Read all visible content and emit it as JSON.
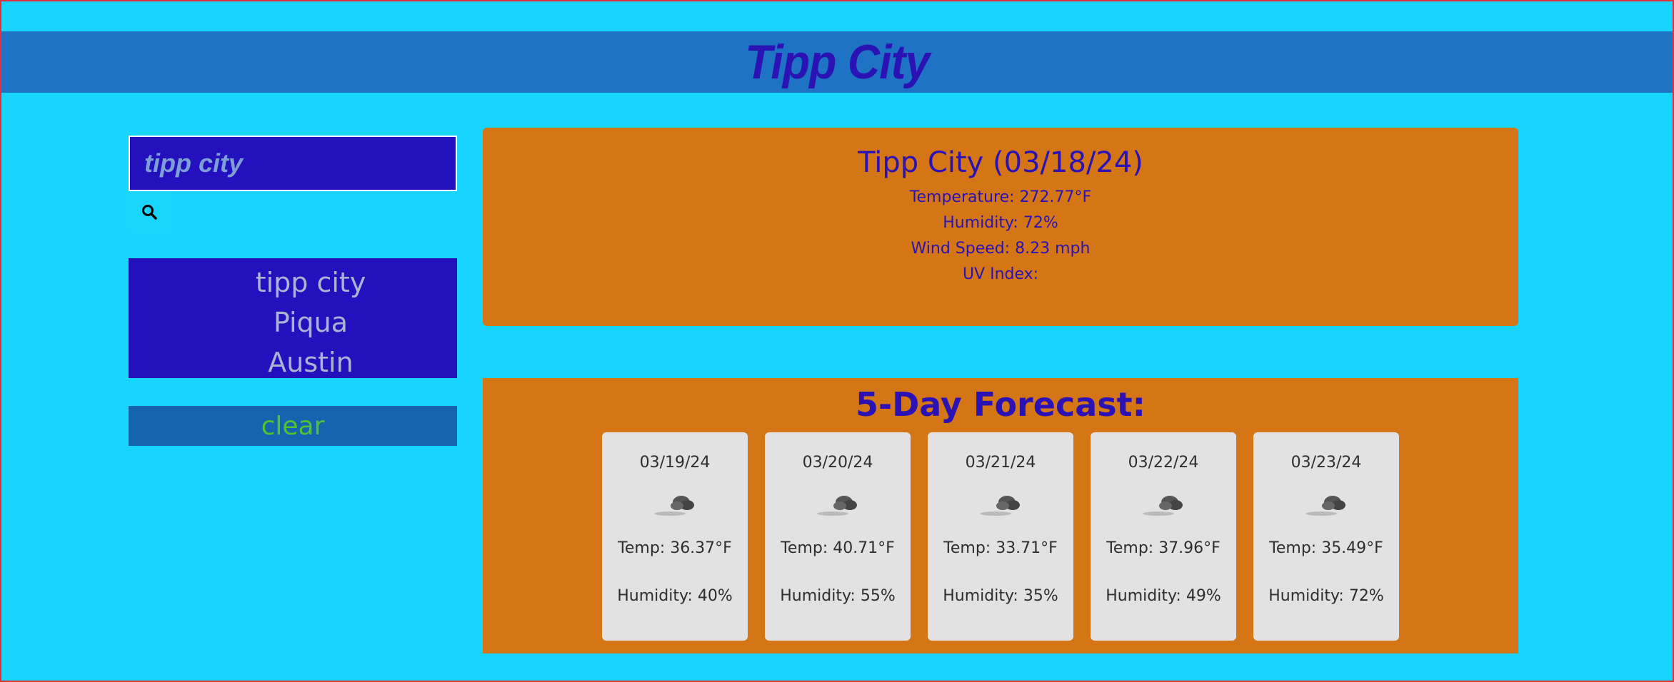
{
  "header": {
    "title": "Tipp City"
  },
  "search": {
    "value": "tipp city",
    "button_icon": "search-icon"
  },
  "history": {
    "items": [
      "tipp city",
      "Piqua",
      "Austin"
    ]
  },
  "clear_label": "clear",
  "current": {
    "title": "Tipp City (03/18/24)",
    "temperature": "Temperature: 272.77°F",
    "humidity": "Humidity: 72%",
    "wind": "Wind Speed: 8.23 mph",
    "uv": "UV Index:"
  },
  "forecast": {
    "heading": "5-Day Forecast:",
    "days": [
      {
        "date": "03/19/24",
        "icon": "cloud-icon",
        "temp": "Temp: 36.37°F",
        "humidity": "Humidity: 40%"
      },
      {
        "date": "03/20/24",
        "icon": "cloud-icon",
        "temp": "Temp: 40.71°F",
        "humidity": "Humidity: 55%"
      },
      {
        "date": "03/21/24",
        "icon": "cloud-icon",
        "temp": "Temp: 33.71°F",
        "humidity": "Humidity: 35%"
      },
      {
        "date": "03/22/24",
        "icon": "cloud-icon",
        "temp": "Temp: 37.96°F",
        "humidity": "Humidity: 49%"
      },
      {
        "date": "03/23/24",
        "icon": "cloud-icon",
        "temp": "Temp: 35.49°F",
        "humidity": "Humidity: 72%"
      }
    ]
  }
}
